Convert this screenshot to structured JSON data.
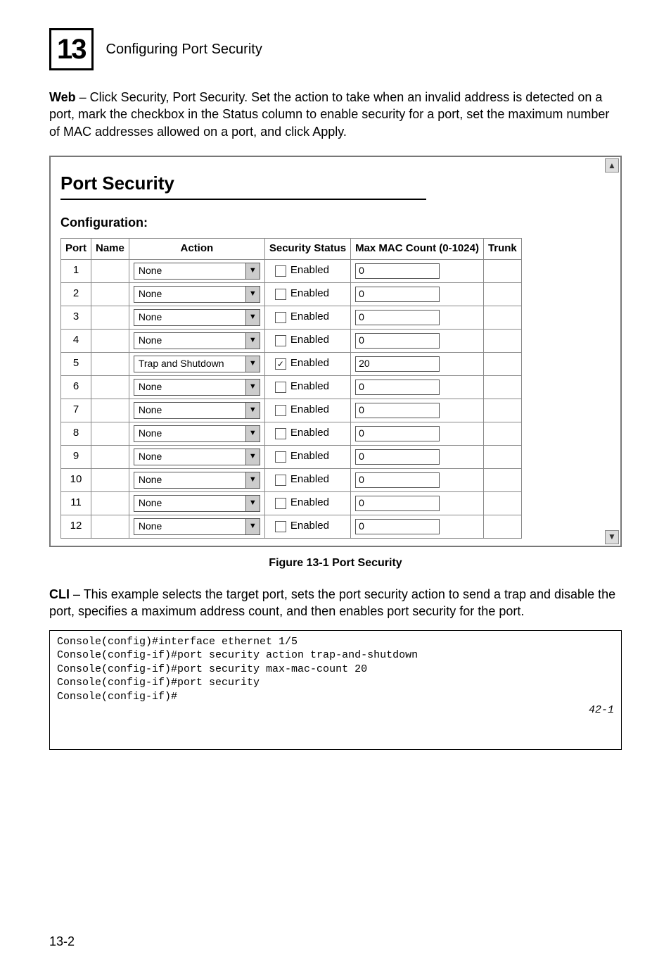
{
  "chapter": {
    "number": "13",
    "title": "Configuring Port Security"
  },
  "intro": "Web – Click Security, Port Security. Set the action to take when an invalid address is detected on a port, mark the checkbox in the Status column to enable security for a port, set the maximum number of MAC addresses allowed on a port, and click Apply.",
  "intro_lead": "Web",
  "intro_rest": " – Click Security, Port Security. Set the action to take when an invalid address is detected on a port, mark the checkbox in the Status column to enable security for a port, set the maximum number of MAC addresses allowed on a port, and click Apply.",
  "panel": {
    "title": "Port Security",
    "subtitle": "Configuration:",
    "headers": [
      "Port",
      "Name",
      "Action",
      "Security Status",
      "Max MAC Count (0-1024)",
      "Trunk"
    ],
    "enabled_label": "Enabled",
    "rows": [
      {
        "port": "1",
        "name": "",
        "action": "None",
        "checked": false,
        "mac": "0",
        "trunk": ""
      },
      {
        "port": "2",
        "name": "",
        "action": "None",
        "checked": false,
        "mac": "0",
        "trunk": ""
      },
      {
        "port": "3",
        "name": "",
        "action": "None",
        "checked": false,
        "mac": "0",
        "trunk": ""
      },
      {
        "port": "4",
        "name": "",
        "action": "None",
        "checked": false,
        "mac": "0",
        "trunk": ""
      },
      {
        "port": "5",
        "name": "",
        "action": "Trap and Shutdown",
        "checked": true,
        "mac": "20",
        "trunk": ""
      },
      {
        "port": "6",
        "name": "",
        "action": "None",
        "checked": false,
        "mac": "0",
        "trunk": ""
      },
      {
        "port": "7",
        "name": "",
        "action": "None",
        "checked": false,
        "mac": "0",
        "trunk": ""
      },
      {
        "port": "8",
        "name": "",
        "action": "None",
        "checked": false,
        "mac": "0",
        "trunk": ""
      },
      {
        "port": "9",
        "name": "",
        "action": "None",
        "checked": false,
        "mac": "0",
        "trunk": ""
      },
      {
        "port": "10",
        "name": "",
        "action": "None",
        "checked": false,
        "mac": "0",
        "trunk": ""
      },
      {
        "port": "11",
        "name": "",
        "action": "None",
        "checked": false,
        "mac": "0",
        "trunk": ""
      },
      {
        "port": "12",
        "name": "",
        "action": "None",
        "checked": false,
        "mac": "0",
        "trunk": ""
      }
    ]
  },
  "figure_caption": "Figure 13-1  Port Security",
  "cli_lead": "CLI",
  "cli_rest": " – This example selects the target port, sets the port security action to send a trap and disable the port, specifies a maximum address count, and then enables port security for the port.",
  "code": {
    "lines": [
      "Console(config)#interface ethernet 1/5",
      "Console(config-if)#port security action trap-and-shutdown",
      "Console(config-if)#port security max-mac-count 20",
      "Console(config-if)#port security",
      "Console(config-if)#"
    ],
    "ref": "42-1"
  },
  "page_number": "13-2"
}
